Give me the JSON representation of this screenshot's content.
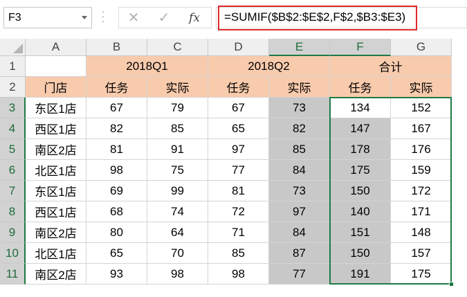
{
  "name_box": {
    "value": "F3"
  },
  "formula_bar": {
    "formula": "=SUMIF($B$2:$E$2,F$2,$B3:$E3)",
    "cancel_icon": "✕",
    "enter_icon": "✓",
    "fx_icon": "fx"
  },
  "columns": [
    "A",
    "B",
    "C",
    "D",
    "E",
    "F",
    "G"
  ],
  "rows": [
    "1",
    "2",
    "3",
    "4",
    "5",
    "6",
    "7",
    "8",
    "9",
    "10",
    "11"
  ],
  "header_row1": {
    "q1": "2018Q1",
    "q2": "2018Q2",
    "total": "合计"
  },
  "header_row2": [
    "门店",
    "任务",
    "实际",
    "任务",
    "实际",
    "任务",
    "实际"
  ],
  "data_rows": [
    [
      "东区1店",
      "67",
      "79",
      "67",
      "73",
      "134",
      "152"
    ],
    [
      "西区1店",
      "82",
      "85",
      "65",
      "82",
      "147",
      "167"
    ],
    [
      "南区2店",
      "81",
      "91",
      "97",
      "85",
      "178",
      "176"
    ],
    [
      "北区1店",
      "98",
      "75",
      "77",
      "84",
      "175",
      "159"
    ],
    [
      "东区1店",
      "69",
      "99",
      "81",
      "73",
      "150",
      "172"
    ],
    [
      "西区1店",
      "68",
      "74",
      "72",
      "97",
      "140",
      "171"
    ],
    [
      "南区2店",
      "80",
      "64",
      "71",
      "84",
      "151",
      "148"
    ],
    [
      "北区1店",
      "65",
      "70",
      "85",
      "87",
      "150",
      "157"
    ],
    [
      "南区2店",
      "93",
      "98",
      "98",
      "77",
      "191",
      "175"
    ]
  ],
  "colors": {
    "header_fill": "#f8cbad",
    "selection_fill": "#c8c8c8",
    "selection_border": "#1d7a45",
    "formula_highlight": "#e0282a"
  },
  "selection": {
    "active_cell": "F3",
    "range": "F3:G11"
  }
}
